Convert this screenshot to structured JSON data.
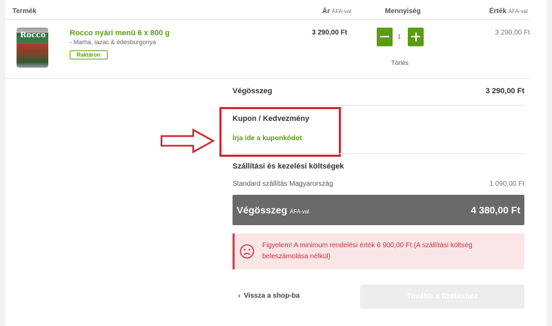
{
  "header": {
    "product": "Termék",
    "price": "Ár",
    "price_sub": "ÁFA-val",
    "quantity": "Mennyiség",
    "value": "Érték",
    "value_sub": "ÁFA-val"
  },
  "product": {
    "can_label": "Rocco",
    "name": "Rocco nyári menü 6 x 800 g",
    "variant": "- Marha, lazac & édesburgonya",
    "stock_badge": "Raktáron",
    "price": "3 290,00 Ft",
    "quantity": "1",
    "delete_label": "Törlés",
    "value": "3 290,00 Ft"
  },
  "summary": {
    "subtotal_label": "Végösszeg",
    "subtotal_value": "3 290,00 Ft",
    "coupon_title": "Kupon / Kedvezmény",
    "coupon_link": "Írja ide a kuponkódot",
    "shipping_title": "Szállítási és kezelési költségek",
    "shipping_method": "Standard szállítás Magyarország",
    "shipping_cost": "1 090,00 Ft",
    "total_label": "Végösszeg",
    "total_sub": "ÁFA-val",
    "total_value": "4 380,00 Ft"
  },
  "warning": {
    "text": "Figyelem! A minimum rendelési érték 6 900,00 Ft (A szállítási költség beleszámolása nélkül)"
  },
  "actions": {
    "back_label": "Vissza a shop-ba",
    "proceed_label": "Tovább a fizetéshez"
  },
  "colors": {
    "brand_green": "#5a9c14",
    "highlight_red": "#d32630",
    "total_bar": "#6a6a6a",
    "warning_bg": "#fbe6e7"
  }
}
